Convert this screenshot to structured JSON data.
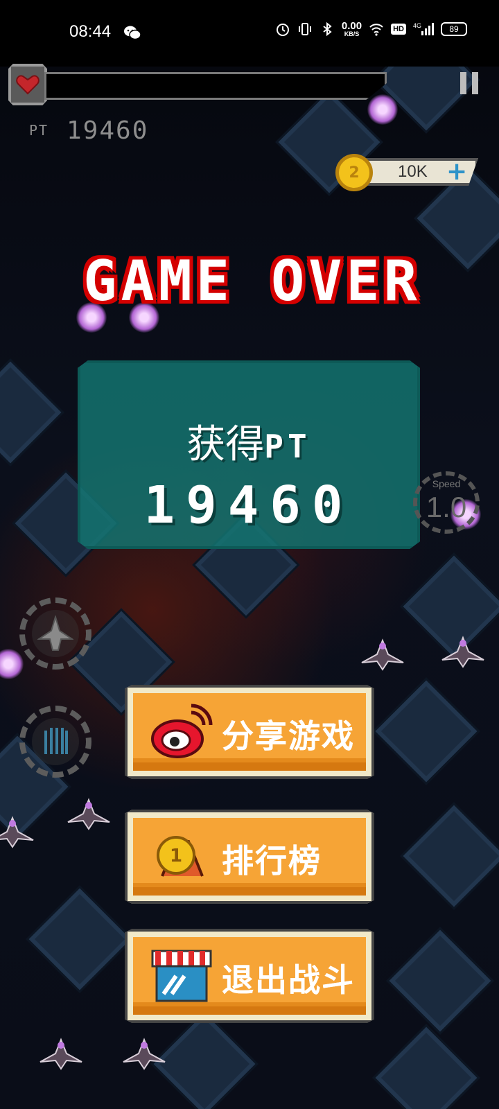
{
  "status_bar": {
    "time": "08:44",
    "net_speed_value": "0.00",
    "net_speed_unit": "KB/S",
    "hd_label": "HD",
    "signal_label": "4G",
    "battery": "89"
  },
  "hud": {
    "pt_label": "PT",
    "pt_value": "19460",
    "coins": "10K",
    "coin_symbol": "2",
    "plus_symbol": "+"
  },
  "game_over": {
    "title": "GAME OVER",
    "earned_label": "获得",
    "pt_label": "PT",
    "score": "19460"
  },
  "speed": {
    "label": "Speed",
    "value": "1.0"
  },
  "menu": {
    "share_label": "分享游戏",
    "leaderboard_label": "排行榜",
    "exit_label": "退出战斗"
  },
  "colors": {
    "title_red": "#d40000",
    "panel_teal": "#14787a",
    "button_orange": "#f6a436",
    "button_border": "#f1e9c9"
  }
}
